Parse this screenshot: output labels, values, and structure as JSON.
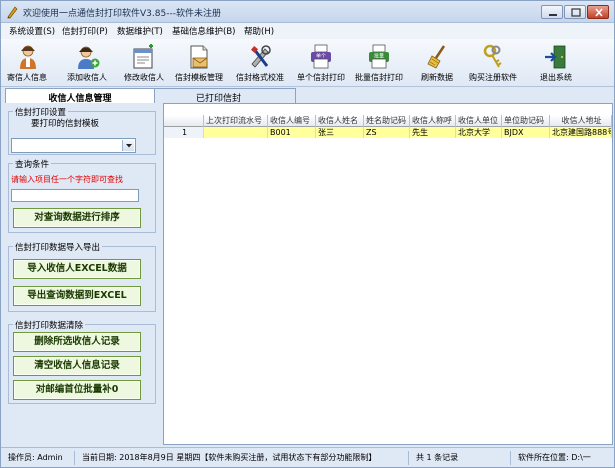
{
  "window": {
    "title": "欢迎使用一点通信封打印软件V3.85---软件未注册"
  },
  "menu": [
    {
      "label": "系统设置(S)"
    },
    {
      "label": "信封打印(P)"
    },
    {
      "label": "数据维护(T)"
    },
    {
      "label": "基础信息维护(B)"
    },
    {
      "label": "帮助(H)"
    }
  ],
  "toolbar": [
    {
      "label": "寄信人信息",
      "icon": "sender-person-icon"
    },
    {
      "label": "添加收信人",
      "icon": "add-recipient-icon"
    },
    {
      "label": "修改收信人",
      "icon": "edit-recipient-icon"
    },
    {
      "label": "信封模板管理",
      "icon": "envelope-template-icon"
    },
    {
      "label": "信封格式校准",
      "icon": "calibrate-tools-icon"
    },
    {
      "label": "单个信封打印",
      "icon": "print-single-icon"
    },
    {
      "label": "批量信封打印",
      "icon": "print-batch-icon"
    },
    {
      "label": "刷新数据",
      "icon": "broom-icon"
    },
    {
      "label": "购买注册软件",
      "icon": "keys-icon"
    },
    {
      "label": "退出系统",
      "icon": "exit-door-icon"
    }
  ],
  "tabs": {
    "active": "收信人信息管理",
    "inactive": "已打印信封"
  },
  "left": {
    "print_settings_legend": "信封打印设置",
    "template_label": "要打印的信封模板",
    "template_value": "",
    "query_legend": "查询条件",
    "query_hint": "请输入项目任一个字符即可查找",
    "query_value": "",
    "sort_button": "对查询数据进行排序",
    "import_legend": "信封打印数据导入导出",
    "import_button": "导入收信人EXCEL数据",
    "export_button": "导出查询数据到EXCEL",
    "clear_legend": "信封打印数据清除",
    "delete_selected_button": "删除所选收信人记录",
    "clear_all_button": "清空收信人信息记录",
    "zip_fill_button": "对邮编首位批量补0"
  },
  "grid": {
    "columns": [
      "上次打印流水号",
      "收信人编号",
      "收信人姓名",
      "姓名助记码",
      "收信人称呼",
      "收信人单位",
      "单位助记码",
      "收信人地址"
    ],
    "rows": [
      {
        "num": "1",
        "cells": [
          "",
          "B001",
          "张三",
          "ZS",
          "先生",
          "北京大学",
          "BJDX",
          "北京建国路888号"
        ]
      }
    ]
  },
  "status": {
    "operator": "操作员: Admin",
    "date": "当前日期: 2018年8月9日 星期四【软件未购买注册，试用状态下有部分功能限制】",
    "records": "共 1 条记录",
    "location": "软件所在位置: D:\\一"
  },
  "colors": {
    "chrome_bg": "#dfe8f5",
    "highlight_row": "#ffff9c",
    "hint_red": "#e00000",
    "button_green_border": "#6e9a3b"
  }
}
